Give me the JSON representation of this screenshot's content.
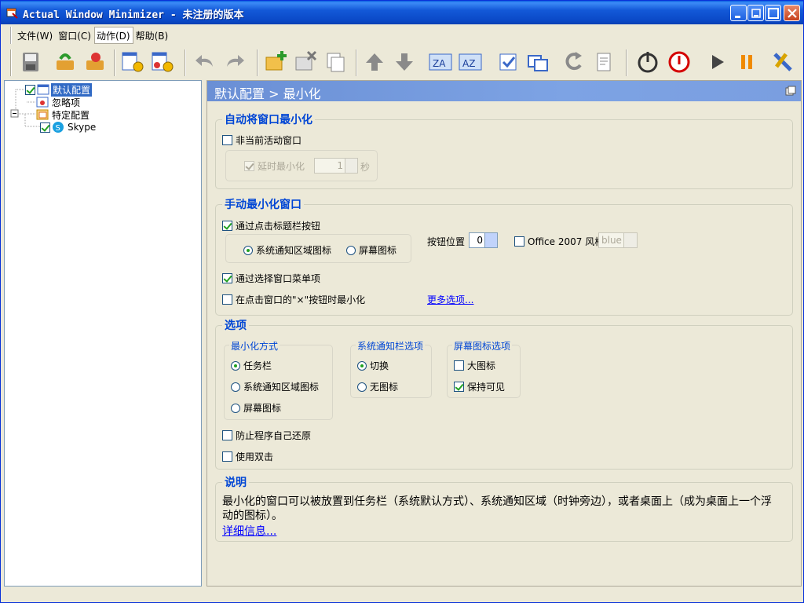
{
  "window": {
    "title": "Actual Window Minimizer - 未注册的版本"
  },
  "menu": [
    {
      "label": "文件(W)"
    },
    {
      "label": "窗口(C)"
    },
    {
      "label": "动作(D)"
    },
    {
      "label": "帮助(B)"
    }
  ],
  "toolbar": [
    "save-icon",
    "load-config-icon",
    "reset-config-icon",
    "default-settings-icon",
    "special-settings-icon",
    "undo-icon",
    "redo-icon",
    "add-window-icon",
    "delete-window-icon",
    "copy-window-icon",
    "move-up-icon",
    "move-down-icon",
    "sort-az-icon",
    "sort-za-icon",
    "check-all-icon",
    "restore-icon",
    "refresh-icon",
    "clipboard-icon",
    "power-icon",
    "stop-icon",
    "play-icon",
    "pause-icon",
    "tools-icon"
  ],
  "tree": {
    "items": [
      {
        "label": "默认配置",
        "checked": true,
        "selected": true
      },
      {
        "label": "忽略项"
      },
      {
        "label": "特定配置",
        "expanded": true
      },
      {
        "label": "Skype",
        "checked": true
      }
    ]
  },
  "panel": {
    "header": "默认配置 > 最小化",
    "auto": {
      "title": "自动将窗口最小化",
      "inactive_label": "非当前活动窗口",
      "inactive_checked": false,
      "delay_label": "延时最小化",
      "delay_checked": true,
      "delay_value": "1",
      "delay_unit": "秒"
    },
    "manual": {
      "title": "手动最小化窗口",
      "titlebar_label": "通过点击标题栏按钮",
      "titlebar_checked": true,
      "radio_tray": "系统通知区域图标",
      "radio_screen": "屏幕图标",
      "radio_selected": "tray",
      "button_pos_label": "按钮位置",
      "button_pos_value": "0",
      "office_label": "Office 2007 风格",
      "office_checked": false,
      "office_value": "blue",
      "menu_label": "通过选择窗口菜单项",
      "menu_checked": true,
      "close_label": "在点击窗口的\"×\"按钮时最小化",
      "close_checked": false,
      "more_link": "更多选项..."
    },
    "options": {
      "title": "选项",
      "min_method_title": "最小化方式",
      "min_method": [
        "任务栏",
        "系统通知区域图标",
        "屏幕图标"
      ],
      "min_method_selected": 0,
      "tray_title": "系统通知栏选项",
      "tray_opts": [
        "切换",
        "无图标"
      ],
      "tray_selected": 0,
      "screen_title": "屏幕图标选项",
      "big_icon_label": "大图标",
      "big_icon_checked": false,
      "keep_visible_label": "保持可见",
      "keep_visible_checked": true,
      "prevent_restore_label": "防止程序自己还原",
      "prevent_restore_checked": false,
      "dblclick_label": "使用双击",
      "dblclick_checked": false
    },
    "desc": {
      "title": "说明",
      "text": "最小化的窗口可以被放置到任务栏（系统默认方式）、系统通知区域（时钟旁边），或者桌面上（成为桌面上一个浮动的图标）。",
      "link": "详细信息..."
    }
  }
}
